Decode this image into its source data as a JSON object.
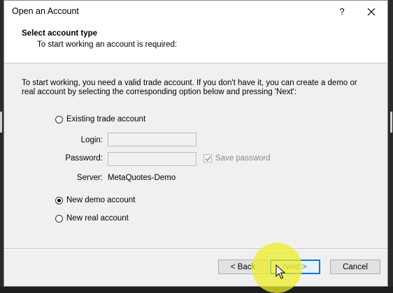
{
  "window": {
    "title": "Open an Account",
    "help_label": "?"
  },
  "header": {
    "title": "Select account type",
    "subtitle": "To start working an account is required:"
  },
  "body": {
    "instructions": "To start working, you need a valid trade account. If you don't have it, you can create a demo or real account by selecting the corresponding option below and pressing 'Next':"
  },
  "options": {
    "existing": {
      "label": "Existing trade account",
      "checked": false
    },
    "demo": {
      "label": "New demo account",
      "checked": true
    },
    "real": {
      "label": "New real account",
      "checked": false
    }
  },
  "login_form": {
    "login_label": "Login:",
    "login_value": "",
    "password_label": "Password:",
    "password_value": "",
    "save_password_label": "Save password",
    "save_password_checked": true,
    "server_label": "Server:",
    "server_value": "MetaQuotes-Demo"
  },
  "buttons": {
    "back": "< Back",
    "next": "Next >",
    "cancel": "Cancel"
  },
  "icons": {
    "close": "close-icon",
    "checkmark": "checkmark-icon",
    "cursor": "mouse-cursor-icon"
  },
  "colors": {
    "accent": "#0078d7",
    "click_highlight": "#eeee28"
  }
}
